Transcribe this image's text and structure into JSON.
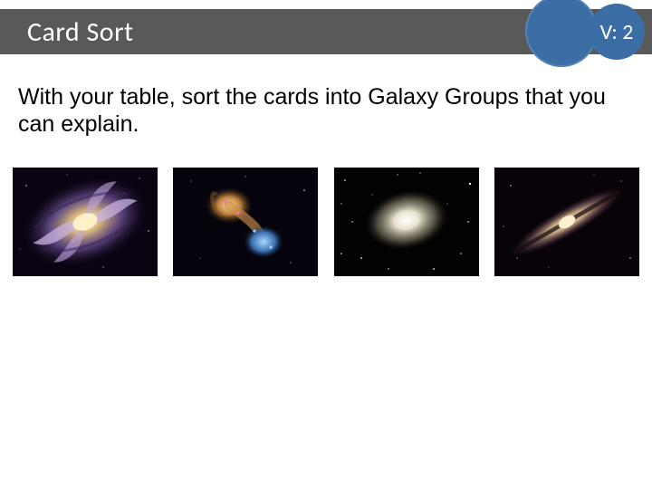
{
  "header": {
    "title": "Card Sort",
    "badge": "V: 2"
  },
  "body": {
    "instruction": "With your table, sort the cards into Galaxy Groups that you can explain."
  },
  "gallery": {
    "items": [
      {
        "name": "spiral-galaxy"
      },
      {
        "name": "interacting-galaxies"
      },
      {
        "name": "elliptical-galaxy"
      },
      {
        "name": "edge-on-galaxy"
      }
    ]
  },
  "colors": {
    "bar": "#595959",
    "accent": "#3a6ea5"
  }
}
